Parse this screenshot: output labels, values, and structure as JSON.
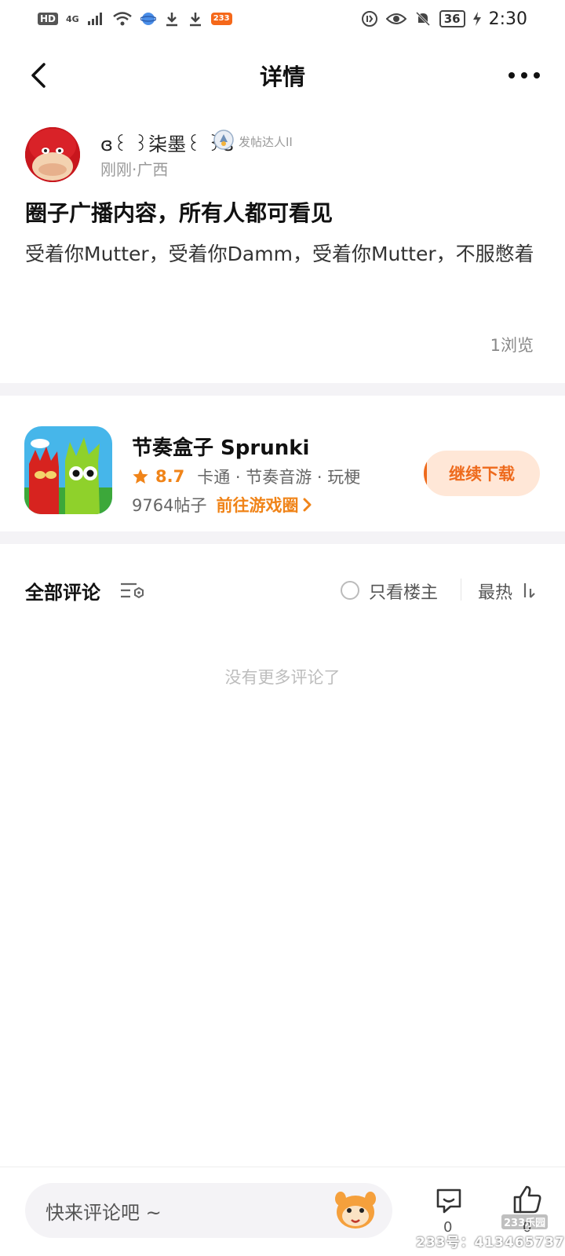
{
  "status_bar": {
    "hd": "HD",
    "network": "4G",
    "app_badge": "233",
    "battery": "36",
    "time": "2:30"
  },
  "header": {
    "title": "详情"
  },
  "post": {
    "author": "ɞ꒰ ꒱柒墨꒰ ꒱ɞ",
    "badge": "发帖达人II",
    "meta": "刚刚·广西",
    "title": "圈子广播内容，所有人都可看见",
    "body": "受着你Mutter，受着你Damm，受着你Mutter，不服憋着",
    "views": "1浏览"
  },
  "game": {
    "name": "节奏盒子 Sprunki",
    "rating": "8.7",
    "tags": "卡通 · 节奏音游 · 玩梗",
    "posts": "9764帖子",
    "circle_link": "前往游戏圈",
    "download_label": "继续下载"
  },
  "comments": {
    "title": "全部评论",
    "owner_only": "只看楼主",
    "sort": "最热",
    "empty": "没有更多评论了"
  },
  "bottom_bar": {
    "input_placeholder": "快来评论吧 ~",
    "comment_count": "0",
    "like_count": "0",
    "logo": "233乐园",
    "watermark": "233号：413465737"
  },
  "colors": {
    "accent": "#f08419",
    "download_bg": "#ffe7d7",
    "divider": "#f4f3f6"
  },
  "icons": [
    "back-arrow-icon",
    "more-icon",
    "badge-icon",
    "star-icon",
    "chevron-right-icon",
    "filter-icon",
    "sort-icon",
    "mascot-icon",
    "comment-icon",
    "thumbs-up-icon"
  ]
}
